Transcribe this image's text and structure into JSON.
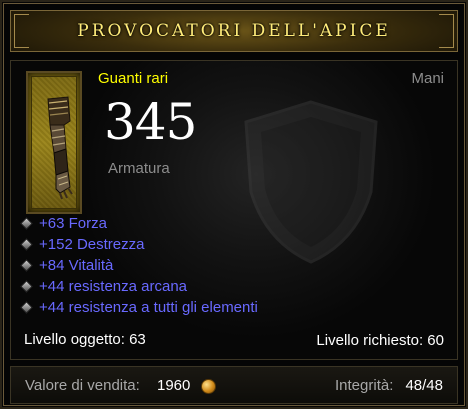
{
  "item": {
    "name": "PROVOCATORI DELL'APICE",
    "rarity": "Guanti rari",
    "slot": "Mani",
    "armor_value": "345",
    "armor_label": "Armatura",
    "icon": "gauntlet-icon",
    "name_color": "#ffec7a",
    "rarity_color": "#ffff00",
    "affix_color": "#6969ff"
  },
  "affixes": [
    "+63 Forza",
    "+152 Destrezza",
    "+84 Vitalità",
    "+44 resistenza arcana",
    "+44 resistenza a tutti gli elementi"
  ],
  "levels": {
    "item_level": "Livello oggetto: 63",
    "required_level": "Livello richiesto: 60"
  },
  "footer": {
    "sell_label": "Valore di vendita:",
    "sell_value": "1960",
    "currency_icon": "gold-coin-icon",
    "durability_label": "Integrità:",
    "durability_value": "48/48"
  }
}
